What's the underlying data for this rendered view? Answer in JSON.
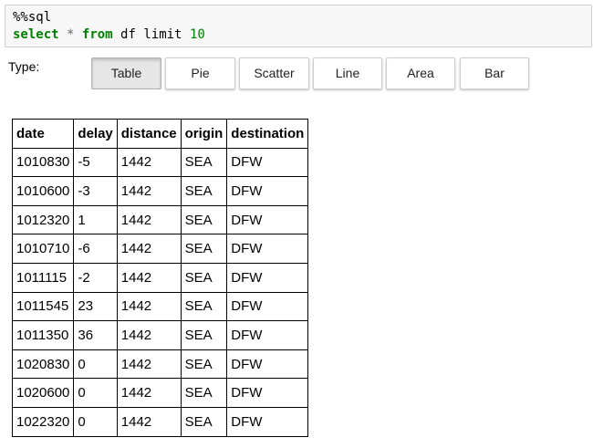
{
  "code": {
    "magic": "%%sql",
    "kw_select": "select",
    "star": "*",
    "kw_from": "from",
    "table": "df",
    "limit_word": "limit",
    "limit_value": "10"
  },
  "type_label": "Type:",
  "buttons": [
    "Table",
    "Pie",
    "Scatter",
    "Line",
    "Area",
    "Bar"
  ],
  "active_button": "Table",
  "table": {
    "columns": [
      "date",
      "delay",
      "distance",
      "origin",
      "destination"
    ],
    "rows": [
      [
        "1010830",
        "-5",
        "1442",
        "SEA",
        "DFW"
      ],
      [
        "1010600",
        "-3",
        "1442",
        "SEA",
        "DFW"
      ],
      [
        "1012320",
        "1",
        "1442",
        "SEA",
        "DFW"
      ],
      [
        "1010710",
        "-6",
        "1442",
        "SEA",
        "DFW"
      ],
      [
        "1011115",
        "-2",
        "1442",
        "SEA",
        "DFW"
      ],
      [
        "1011545",
        "23",
        "1442",
        "SEA",
        "DFW"
      ],
      [
        "1011350",
        "36",
        "1442",
        "SEA",
        "DFW"
      ],
      [
        "1020830",
        "0",
        "1442",
        "SEA",
        "DFW"
      ],
      [
        "1020600",
        "0",
        "1442",
        "SEA",
        "DFW"
      ],
      [
        "1022320",
        "0",
        "1442",
        "SEA",
        "DFW"
      ]
    ]
  }
}
